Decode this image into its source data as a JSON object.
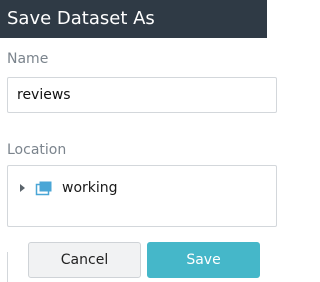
{
  "dialog": {
    "title": "Save Dataset As"
  },
  "name_field": {
    "label": "Name",
    "value": "reviews"
  },
  "location_field": {
    "label": "Location",
    "tree": [
      {
        "label": "working",
        "icon": "folder-icon",
        "expanded": false
      }
    ]
  },
  "buttons": {
    "cancel_label": "Cancel",
    "save_label": "Save"
  },
  "colors": {
    "titlebar_bg": "#2f3a45",
    "primary_button": "#45b7c9",
    "folder_icon": "#4aa6d6"
  }
}
